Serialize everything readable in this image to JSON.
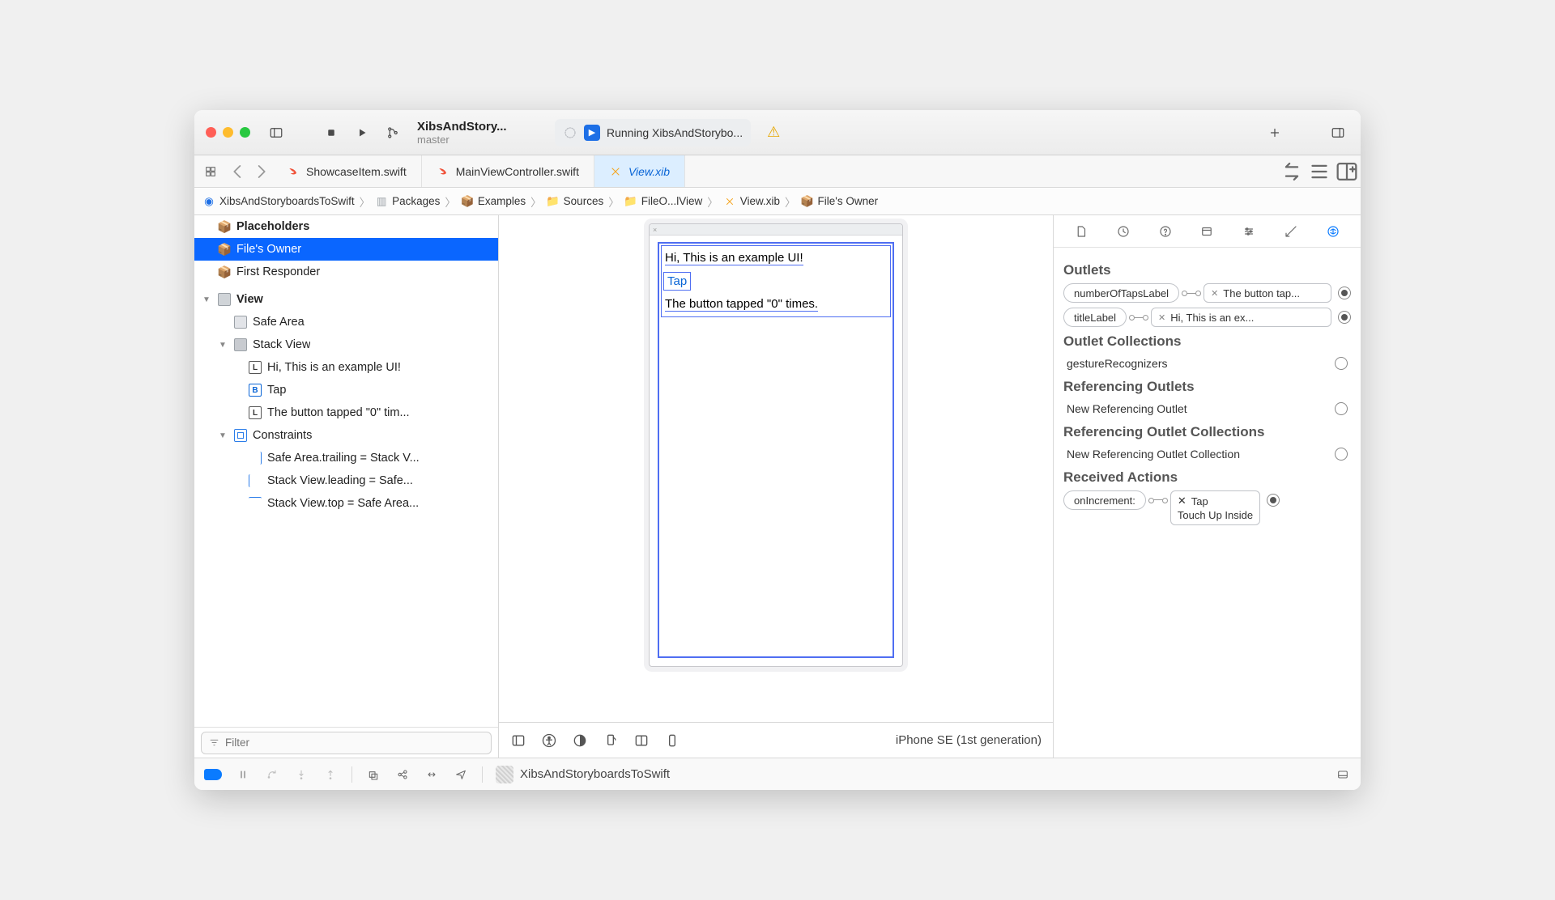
{
  "title": {
    "project": "XibsAndStory...",
    "branch": "master"
  },
  "run": {
    "status": "Running XibsAndStorybo..."
  },
  "tabs": {
    "t1": "ShowcaseItem.swift",
    "t2": "MainViewController.swift",
    "t3": "View.xib"
  },
  "jumpbar": {
    "p0": "XibsAndStoryboardsToSwift",
    "p1": "Packages",
    "p2": "Examples",
    "p3": "Sources",
    "p4": "FileO...lView",
    "p5": "View.xib",
    "p6": "File's Owner"
  },
  "outline": {
    "placeholders": "Placeholders",
    "filesOwner": "File's Owner",
    "firstResponder": "First Responder",
    "view": "View",
    "safeArea": "Safe Area",
    "stackView": "Stack View",
    "label1": "Hi, This is an example UI!",
    "button": "Tap",
    "label2": "The button tapped \"0\" tim...",
    "constraints": "Constraints",
    "c1": "Safe Area.trailing = Stack V...",
    "c2": "Stack View.leading = Safe...",
    "c3": "Stack View.top = Safe Area...",
    "filterPlaceholder": "Filter"
  },
  "canvas": {
    "titleLabel": "Hi, This is an example UI!",
    "tapButton": "Tap",
    "countLabel": "The button tapped \"0\" times.",
    "deviceName": "iPhone SE (1st generation)"
  },
  "inspector": {
    "outlets": "Outlets",
    "o1name": "numberOfTapsLabel",
    "o1targ": "The button tap...",
    "o2name": "titleLabel",
    "o2targ": "Hi, This is an ex...",
    "outletCollections": "Outlet Collections",
    "gesture": "gestureRecognizers",
    "refOutlets": "Referencing Outlets",
    "newRef": "New Referencing Outlet",
    "refOutletCols": "Referencing Outlet Collections",
    "newRefCol": "New Referencing Outlet Collection",
    "receivedActions": "Received Actions",
    "actionName": "onIncrement:",
    "actionTarget": "Tap",
    "actionEvent": "Touch Up Inside"
  },
  "footer": {
    "project": "XibsAndStoryboardsToSwift"
  },
  "letters": {
    "L": "L",
    "B": "B"
  }
}
